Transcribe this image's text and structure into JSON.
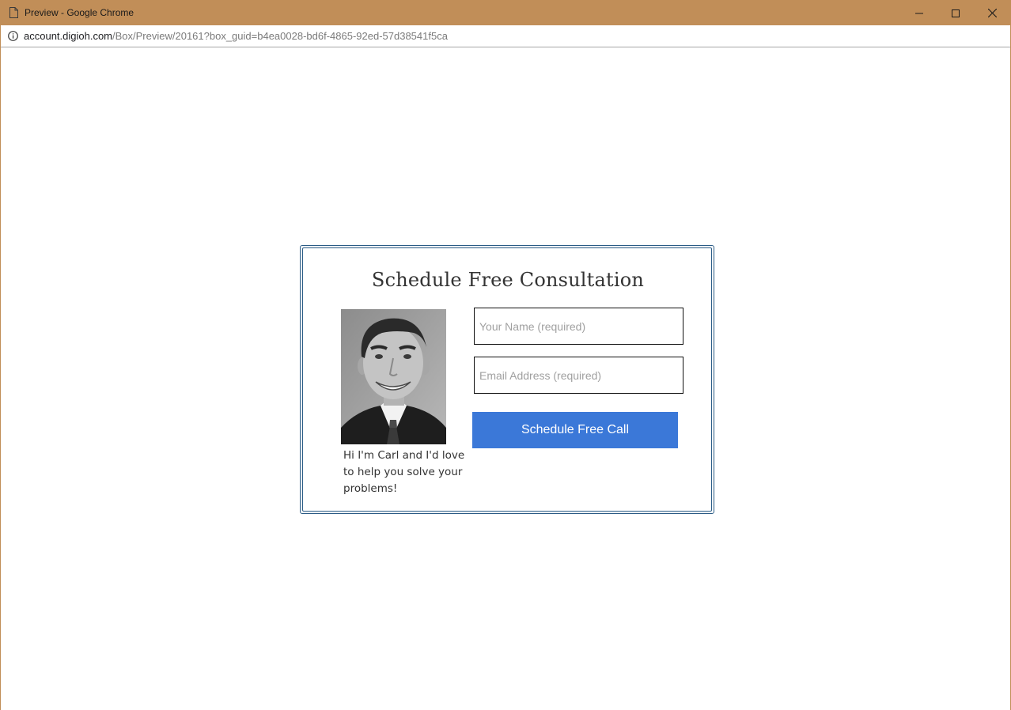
{
  "window": {
    "title": "Preview - Google Chrome",
    "title_bar_color": "#c18e58"
  },
  "address_bar": {
    "url_host": "account.digioh.com",
    "url_path": "/Box/Preview/20161?box_guid=b4ea0028-bd6f-4865-92ed-57d38541f5ca"
  },
  "popup": {
    "title": "Schedule Free Consultation",
    "caption": "Hi I'm Carl and I'd love to help you solve your problems!",
    "name_placeholder": "Your Name (required)",
    "email_placeholder": "Email Address (required)",
    "submit_label": "Schedule Free Call",
    "accent_color": "#3b78d8",
    "border_color": "#2b5c86"
  }
}
